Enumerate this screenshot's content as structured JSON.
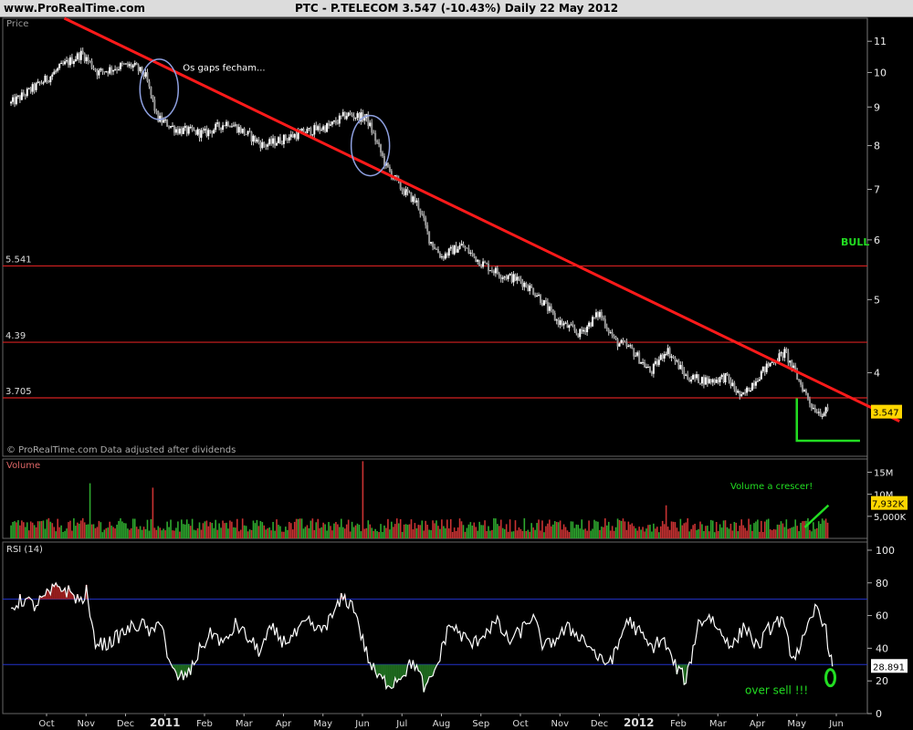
{
  "header": {
    "site": "www.ProRealTime.com",
    "title": "PTC - P.TELECOM    3.547  (-10.43%)    Daily  22 May 2012"
  },
  "colors": {
    "background": "#000000",
    "candle": "#ffffff",
    "trendline": "#ff1a1a",
    "hline": "#d42020",
    "annotation_green": "#22dd22",
    "rsi_line": "#ffffff",
    "rsi_level": "#2233cc",
    "circle": "#8ea0e0"
  },
  "chart_data": [
    {
      "type": "candlestick",
      "panel": "price",
      "panel_label": "Price",
      "footer_note": "© ProRealTime.com  Data adjusted after dividends",
      "symbol": "PTC - P.TELECOM",
      "last": 3.547,
      "change": "-10.43%",
      "period": "Daily",
      "date": "22 May 2012",
      "ylim": [
        3.1,
        11.8
      ],
      "log_scale": true,
      "yticks": [
        4,
        5,
        6,
        7,
        8,
        9,
        10,
        11
      ],
      "x_labels": [
        "Oct",
        "Nov",
        "Dec",
        "2011",
        "Feb",
        "Mar",
        "Apr",
        "May",
        "Jun",
        "Jul",
        "Aug",
        "Sep",
        "Oct",
        "Nov",
        "Dec",
        "2012",
        "Feb",
        "Mar",
        "Apr",
        "May",
        "Jun"
      ],
      "x_label_months": [
        0,
        1,
        2,
        3,
        4,
        5,
        6,
        7,
        8,
        9,
        10,
        11,
        12,
        13,
        14,
        15,
        16,
        17,
        18,
        19,
        20
      ],
      "closes_monthly": {
        "months": [
          -0.9,
          -0.5,
          0.0,
          0.4,
          0.9,
          1.3,
          1.9,
          2.2,
          2.5,
          2.8,
          3.3,
          4.0,
          4.6,
          5.5,
          6.4,
          7.2,
          7.6,
          8.1,
          8.6,
          9.0,
          9.4,
          9.7,
          10.0,
          10.5,
          11.0,
          11.5,
          12.0,
          12.4,
          12.9,
          13.5,
          14.0,
          14.4,
          14.8,
          15.3,
          15.7,
          16.2,
          16.8,
          17.2,
          17.6,
          18.0,
          18.4,
          18.7,
          19.0,
          19.4,
          19.6,
          19.8
        ],
        "values": [
          9.1,
          9.4,
          9.8,
          10.2,
          10.6,
          10.0,
          10.2,
          10.2,
          9.9,
          8.7,
          8.4,
          8.3,
          8.6,
          8.0,
          8.3,
          8.5,
          8.8,
          8.7,
          7.5,
          7.0,
          6.7,
          6.0,
          5.7,
          5.9,
          5.6,
          5.4,
          5.3,
          5.1,
          4.7,
          4.5,
          4.8,
          4.4,
          4.3,
          4.0,
          4.3,
          3.95,
          3.9,
          3.95,
          3.7,
          3.95,
          4.15,
          4.25,
          3.95,
          3.6,
          3.547,
          3.547
        ]
      },
      "trendline": {
        "from": {
          "month": 0.45,
          "value": 11.8
        },
        "to": {
          "month": 21.6,
          "value": 3.45
        }
      },
      "horizontal_lines": [
        {
          "value": 5.541,
          "label": "5.541"
        },
        {
          "value": 4.39,
          "label": "4.39"
        },
        {
          "value": 3.705,
          "label": "3.705"
        }
      ],
      "last_price_label": "3.547",
      "annotations": {
        "gaps": "Os gaps fecham...",
        "bull": "BULL"
      },
      "gap_circles": [
        {
          "month": 2.85,
          "value": 9.5
        },
        {
          "month": 8.2,
          "value": 8.0
        }
      ],
      "support_line": {
        "from": {
          "month": 19.0,
          "value": 3.25
        },
        "to": {
          "month": 20.6,
          "value": 3.25
        }
      }
    },
    {
      "type": "bar",
      "panel": "volume",
      "panel_label": "Volume",
      "yticks_labels": [
        "15M",
        "10M",
        "5,000K"
      ],
      "yticks_values": [
        15000000,
        10000000,
        5000000
      ],
      "ylim": [
        0,
        18000000
      ],
      "last_value_label": "7,932K",
      "annotation": "Volume a crescer!",
      "typical_level": 4000000,
      "spikes": [
        {
          "month": 1.1,
          "value": 12500000
        },
        {
          "month": 2.7,
          "value": 11500000
        },
        {
          "month": 8.0,
          "value": 17500000
        },
        {
          "month": 15.7,
          "value": 7500000
        },
        {
          "month": 19.9,
          "value": 7932000
        }
      ]
    },
    {
      "type": "line",
      "panel": "rsi",
      "panel_label": "RSI (14)",
      "ylim": [
        0,
        105
      ],
      "yticks": [
        0,
        20,
        40,
        60,
        80,
        100
      ],
      "levels": [
        70,
        30
      ],
      "last_value_label": "28.891",
      "annotation": "over sell !!!",
      "months": [
        -0.9,
        -0.6,
        -0.3,
        0.0,
        0.3,
        0.6,
        0.9,
        1.0,
        1.2,
        1.5,
        1.8,
        2.1,
        2.4,
        2.7,
        2.9,
        3.1,
        3.3,
        3.6,
        3.9,
        4.2,
        4.5,
        4.8,
        5.1,
        5.4,
        5.7,
        6.0,
        6.3,
        6.6,
        6.9,
        7.2,
        7.5,
        7.8,
        8.0,
        8.2,
        8.4,
        8.7,
        9.0,
        9.3,
        9.6,
        9.9,
        10.2,
        10.5,
        10.8,
        11.1,
        11.4,
        11.7,
        12.0,
        12.3,
        12.6,
        12.9,
        13.2,
        13.5,
        13.8,
        14.1,
        14.4,
        14.7,
        15.0,
        15.3,
        15.6,
        15.9,
        16.2,
        16.5,
        16.8,
        17.1,
        17.4,
        17.7,
        18.0,
        18.3,
        18.6,
        18.9,
        19.2,
        19.5,
        19.7,
        19.9
      ],
      "values": [
        65,
        70,
        66,
        72,
        78,
        74,
        68,
        76,
        45,
        42,
        47,
        52,
        55,
        48,
        60,
        30,
        22,
        24,
        40,
        50,
        42,
        55,
        46,
        38,
        52,
        44,
        48,
        56,
        50,
        58,
        71,
        65,
        45,
        30,
        22,
        18,
        24,
        32,
        14,
        30,
        55,
        48,
        42,
        50,
        56,
        44,
        50,
        60,
        40,
        46,
        52,
        48,
        40,
        30,
        36,
        58,
        50,
        40,
        46,
        30,
        20,
        55,
        60,
        48,
        42,
        54,
        40,
        52,
        58,
        34,
        46,
        66,
        55,
        28.891
      ]
    }
  ]
}
